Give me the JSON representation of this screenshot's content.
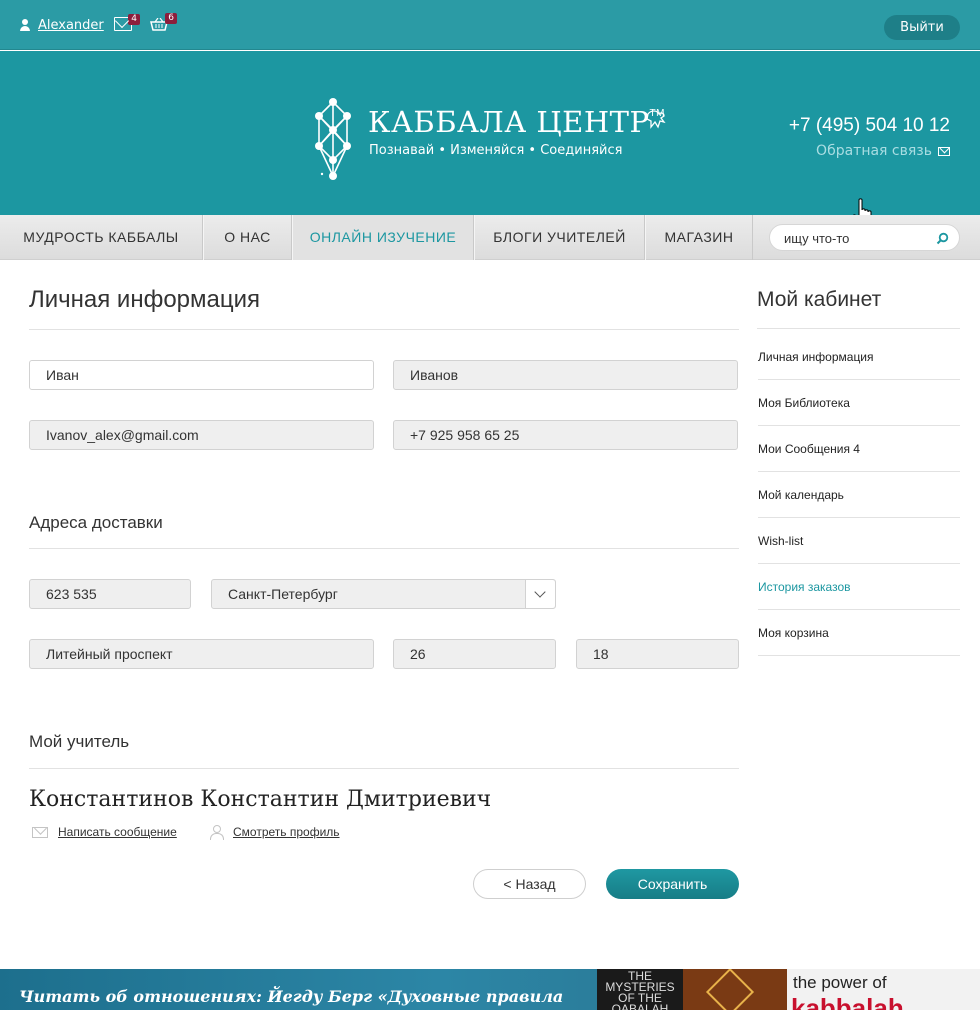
{
  "topbar": {
    "username": "Alexander",
    "messages_count": "4",
    "cart_count": "6",
    "logout_label": "Выйти"
  },
  "header": {
    "logo_title": "КАББАЛА ЦЕНТР",
    "logo_tm": "TM",
    "tagline": "Познавай • Изменяйся • Соединяйся",
    "phone": "+7 (495) 504 10 12",
    "feedback_label": "Обратная связь"
  },
  "nav": {
    "items": [
      {
        "label": "МУДРОСТЬ КАББАЛЫ"
      },
      {
        "label": "О НАС"
      },
      {
        "label": "ОНЛАЙН ИЗУЧЕНИЕ",
        "active": true
      },
      {
        "label": "БЛОГИ УЧИТЕЛЕЙ"
      },
      {
        "label": "МАГАЗИН"
      }
    ],
    "search_value": "ищу что-то"
  },
  "main": {
    "title": "Личная информация",
    "first_name": "Иван",
    "last_name": "Иванов",
    "email": "Ivanov_alex@gmail.com",
    "phone": "+7 925 958 65 25",
    "delivery_title": "Адреса доставки",
    "zip": "623 535",
    "city": "Санкт-Петербург",
    "street": "Литейный проспект",
    "house": "26",
    "apartment": "18",
    "teacher_title": "Мой учитель",
    "teacher_name": "Константинов Константин Дмитриевич",
    "write_message": "Написать сообщение",
    "view_profile": "Смотреть профиль",
    "back_label": "< Назад",
    "save_label": "Сохранить"
  },
  "sidebar": {
    "title": "Мой кабинет",
    "items": [
      {
        "label": "Личная информация"
      },
      {
        "label": "Моя Библиотека"
      },
      {
        "label": "Мои Сообщения 4"
      },
      {
        "label": "Мой календарь"
      },
      {
        "label": "Wish-list"
      },
      {
        "label": "История заказов",
        "active": true
      },
      {
        "label": "Моя корзина"
      }
    ]
  },
  "banner": {
    "text": "Читать об отношениях: Йегду Берг «Духовные правила",
    "book1_title": "THE MYSTERIES OF THE QABALAH",
    "book3_line1": "the power of",
    "book3_line2": "kabbalah"
  },
  "colors": {
    "brand_teal": "#1c97a1",
    "topbar_teal": "#2b9ba5",
    "badge": "#8c1e3c"
  }
}
